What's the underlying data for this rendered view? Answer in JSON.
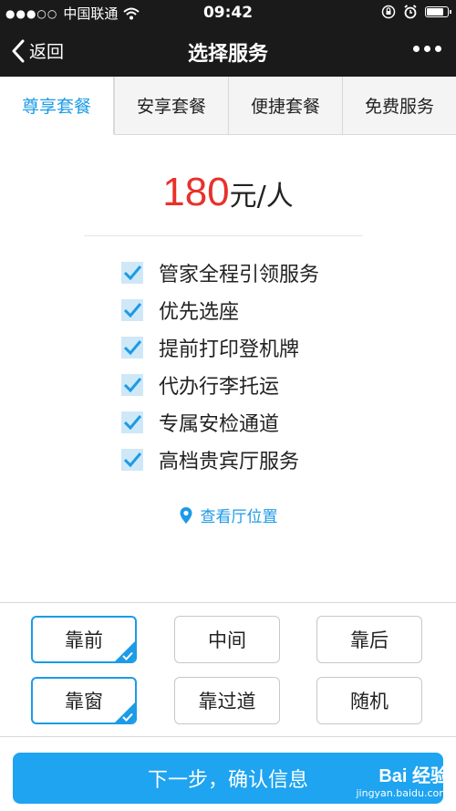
{
  "status_bar": {
    "signal_dots": "●●●○○",
    "carrier": "中国联通",
    "time": "09:42",
    "battery_level": 0.85
  },
  "nav": {
    "back_label": "返回",
    "title": "选择服务"
  },
  "tabs": [
    {
      "label": "尊享套餐",
      "active": true
    },
    {
      "label": "安享套餐",
      "active": false
    },
    {
      "label": "便捷套餐",
      "active": false
    },
    {
      "label": "免费服务",
      "active": false
    }
  ],
  "price": {
    "amount": "180",
    "unit": "元/人"
  },
  "features": [
    "管家全程引领服务",
    "优先选座",
    "提前打印登机牌",
    "代办行李托运",
    "专属安检通道",
    "高档贵宾厅服务"
  ],
  "location_link": "查看厅位置",
  "seat_options": {
    "row1": [
      {
        "label": "靠前",
        "selected": true
      },
      {
        "label": "中间",
        "selected": false
      },
      {
        "label": "靠后",
        "selected": false
      }
    ],
    "row2": [
      {
        "label": "靠窗",
        "selected": true
      },
      {
        "label": "靠过道",
        "selected": false
      },
      {
        "label": "随机",
        "selected": false
      }
    ]
  },
  "next_button": "下一步，确认信息",
  "watermark": {
    "brand": "Bai 经验",
    "url": "jingyan.baidu.com"
  },
  "colors": {
    "accent": "#1c9be6",
    "price": "#e8312b",
    "bar": "#1a1a1a"
  },
  "icons": [
    "wifi-icon",
    "rotation-lock-icon",
    "alarm-icon",
    "battery-icon",
    "back-chevron-icon",
    "more-icon",
    "checkbox-checked-icon",
    "location-pin-icon",
    "checkmark-icon"
  ]
}
